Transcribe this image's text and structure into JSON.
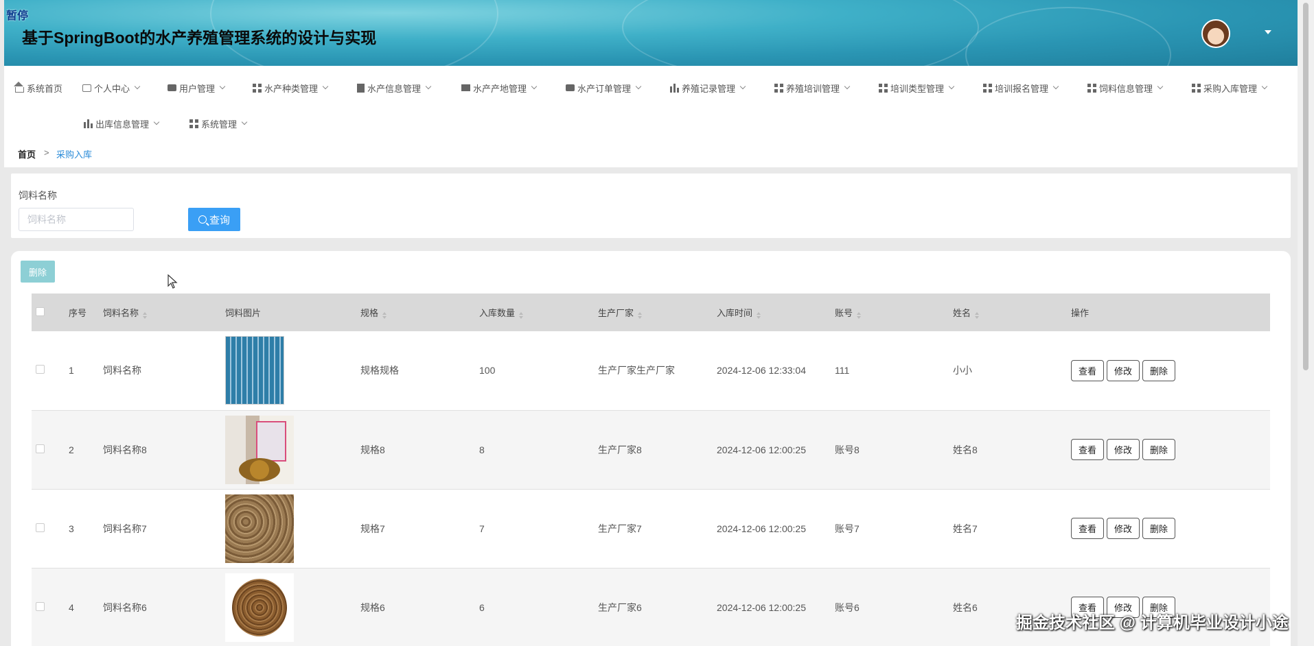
{
  "overlay": {
    "pause_label": "暂停"
  },
  "header": {
    "title": "基于SpringBoot的水产养殖管理系统的设计与实现"
  },
  "nav": {
    "items": [
      {
        "label": "系统首页",
        "icon": "home-icon",
        "dropdown": false
      },
      {
        "label": "个人中心",
        "icon": "card-icon",
        "dropdown": true
      },
      {
        "label": "用户管理",
        "icon": "chat-icon",
        "dropdown": true
      },
      {
        "label": "水产种类管理",
        "icon": "grid-icon",
        "dropdown": true
      },
      {
        "label": "水产信息管理",
        "icon": "document-icon",
        "dropdown": true
      },
      {
        "label": "水产产地管理",
        "icon": "truck-icon",
        "dropdown": true
      },
      {
        "label": "水产订单管理",
        "icon": "bag-icon",
        "dropdown": true
      },
      {
        "label": "养殖记录管理",
        "icon": "book-icon",
        "dropdown": true
      },
      {
        "label": "养殖培训管理",
        "icon": "grid-icon",
        "dropdown": true
      },
      {
        "label": "培训类型管理",
        "icon": "grid-icon",
        "dropdown": true
      },
      {
        "label": "培训报名管理",
        "icon": "grid-icon",
        "dropdown": true
      },
      {
        "label": "饲料信息管理",
        "icon": "grid-icon",
        "dropdown": true
      },
      {
        "label": "采购入库管理",
        "icon": "grid-icon",
        "dropdown": true
      },
      {
        "label": "出库信息管理",
        "icon": "bar-chart-icon",
        "dropdown": true
      },
      {
        "label": "系统管理",
        "icon": "grid-icon",
        "dropdown": true
      }
    ]
  },
  "breadcrumb": {
    "home": "首页",
    "separator": ">",
    "current": "采购入库"
  },
  "search": {
    "label": "饲料名称",
    "placeholder": "饲料名称",
    "value": "",
    "button_label": "查询"
  },
  "toolbar": {
    "delete_label": "删除"
  },
  "table": {
    "headers": [
      "序号",
      "饲料名称",
      "饲料图片",
      "规格",
      "入库数量",
      "生产厂家",
      "入库时间",
      "账号",
      "姓名",
      "操作"
    ],
    "rows": [
      {
        "index": "1",
        "name": "饲料名称",
        "spec": "规格规格",
        "qty": "100",
        "maker": "生产厂家生产厂家",
        "time": "2024-12-06 12:33:04",
        "account": "111",
        "person": "小小"
      },
      {
        "index": "2",
        "name": "饲料名称8",
        "spec": "规格8",
        "qty": "8",
        "maker": "生产厂家8",
        "time": "2024-12-06 12:00:25",
        "account": "账号8",
        "person": "姓名8"
      },
      {
        "index": "3",
        "name": "饲料名称7",
        "spec": "规格7",
        "qty": "7",
        "maker": "生产厂家7",
        "time": "2024-12-06 12:00:25",
        "account": "账号7",
        "person": "姓名7"
      },
      {
        "index": "4",
        "name": "饲料名称6",
        "spec": "规格6",
        "qty": "6",
        "maker": "生产厂家6",
        "time": "2024-12-06 12:00:25",
        "account": "账号6",
        "person": "姓名6"
      }
    ],
    "actions": {
      "view": "查看",
      "edit": "修改",
      "delete": "删除"
    }
  },
  "watermark": "掘金技术社区 @ 计算机毕业设计小途",
  "colors": {
    "primary": "#3a9ff5",
    "link": "#2a8bd8",
    "header_teal": "#2a95b3",
    "batch_delete": "#8dcfd5"
  }
}
